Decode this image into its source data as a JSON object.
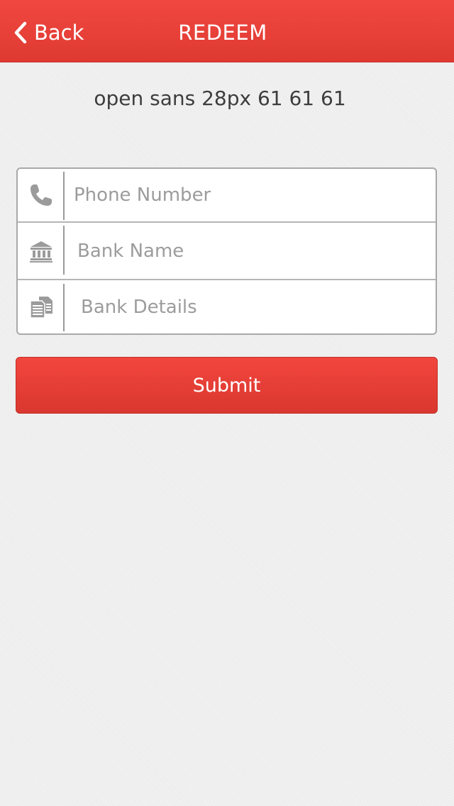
{
  "header": {
    "back_label": "Back",
    "title": "REDEEM",
    "background_color": "#e8413a"
  },
  "subtitle": "open sans 28px 61 61 61",
  "form": {
    "fields": [
      {
        "icon": "phone-icon",
        "placeholder": "Phone Number",
        "value": ""
      },
      {
        "icon": "bank-icon",
        "placeholder": "Bank Name",
        "value": ""
      },
      {
        "icon": "documents-icon",
        "placeholder": "Bank Details",
        "value": ""
      }
    ]
  },
  "submit": {
    "label": "Submit",
    "color": "#e63d35"
  }
}
